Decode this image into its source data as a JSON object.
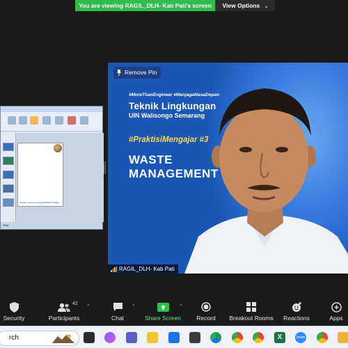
{
  "banner": {
    "viewing_text": "You are viewing RAGIL_DLH- Kab Pati's screen",
    "view_options_label": "View Options"
  },
  "left_share": {
    "caption": "Sumber: suara.com/Upah RANKE TAKER ... ",
    "status": "Slide"
  },
  "video": {
    "remove_pin_label": "Remove Pin",
    "hashtags": "#MoreThanEngineer #MenjagaMasaDepan",
    "department": "Teknik Lingkungan",
    "university": "UIN Walisongo Semarang",
    "program": "#PraktisiMengajar #3",
    "topic_line1": "WASTE",
    "topic_line2": "MANAGEMENT",
    "participant_name": "RAGIL_DLH- Kab Pati"
  },
  "toolbar": {
    "security": "Security",
    "participants": "Participants",
    "participants_count": "42",
    "chat": "Chat",
    "share_screen": "Share Screen",
    "record": "Record",
    "breakout_rooms": "Breakout Rooms",
    "reactions": "Reactions",
    "apps": "Apps"
  },
  "taskbar": {
    "search_text": "rch",
    "zoom_label": "zoom"
  },
  "colors": {
    "banner_green": "#2fbd4e",
    "video_blue": "#1956b5",
    "share_green": "#6fe08a",
    "program_yellow": "#ffd74a"
  }
}
